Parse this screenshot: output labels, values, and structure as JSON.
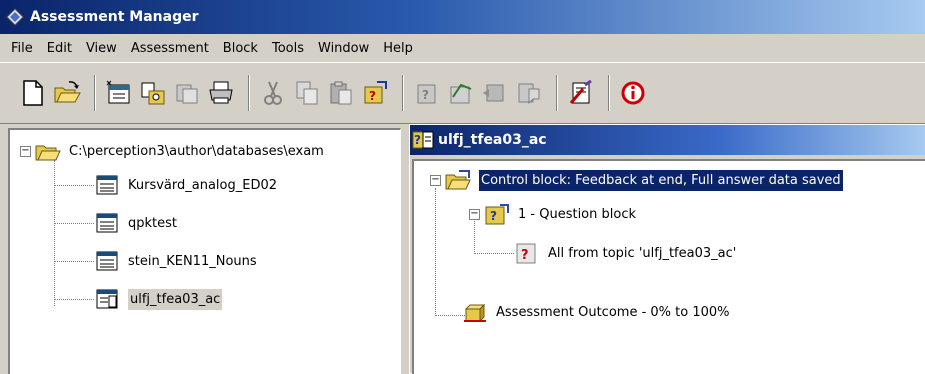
{
  "window": {
    "title": "Assessment Manager"
  },
  "menu": [
    "File",
    "Edit",
    "View",
    "Assessment",
    "Block",
    "Tools",
    "Window",
    "Help"
  ],
  "toolbar": {
    "buttons": [
      "new-icon",
      "open-icon",
      "new-assessment-icon",
      "properties-icon",
      "preview-icon",
      "print-icon",
      "cut-icon",
      "copy-icon",
      "paste-icon",
      "add-question-icon",
      "edit-question-icon",
      "schedule-icon",
      "publish-icon",
      "report-icon",
      "wizard-icon",
      "info-icon"
    ]
  },
  "left_tree": {
    "root": "C:\\perception3\\author\\databases\\exam",
    "items": [
      "Kursvärd_analog_ED02",
      "qpktest",
      "stein_KEN11_Nouns",
      "ulfj_tfea03_ac"
    ]
  },
  "child_window": {
    "title": "ulfj_tfea03_ac",
    "control_block": "Control block: Feedback at end, Full answer data saved",
    "question_block": "1 - Question block",
    "topic": "All from topic 'ulfj_tfea03_ac'",
    "outcome": "Assessment Outcome - 0% to 100%"
  },
  "colors": {
    "title_active": "#0a246a",
    "face": "#d4d0c8",
    "selection": "#0a246a"
  }
}
